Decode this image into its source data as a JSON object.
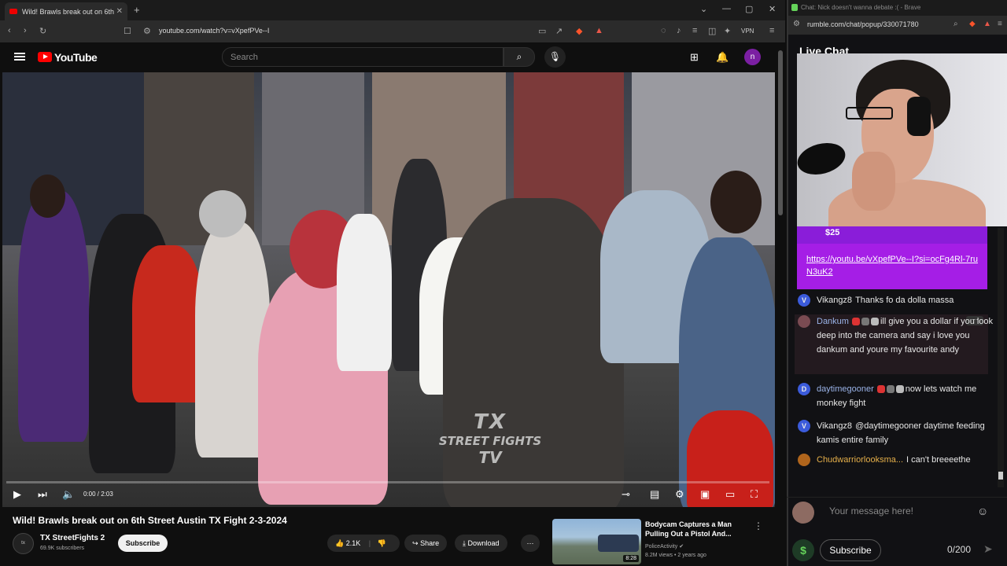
{
  "left_browser": {
    "tab_title": "Wild! Brawls break out on 6th",
    "url": "youtube.com/watch?v=vXpefPVe--I",
    "vpn_label": "VPN"
  },
  "youtube": {
    "logo_text": "YouTube",
    "search_placeholder": "Search",
    "avatar_letter": "n",
    "video": {
      "watermark_line1": "TX",
      "watermark_line2": "STREET FIGHTS",
      "watermark_line3": "TV",
      "time": "0:00 / 2:03",
      "progress": 0.0
    },
    "title": "Wild! Brawls break out on 6th Street Austin TX Fight 2-3-2024",
    "channel": {
      "name": "TX StreetFights 2",
      "subs": "69.9K subscribers",
      "avatar_text": "tx"
    },
    "subscribe_label": "Subscribe",
    "likes": "2.1K",
    "share_label": "Share",
    "download_label": "Download",
    "recommended": {
      "title": "Bodycam Captures a Man Pulling Out a Pistol And...",
      "channel": "PoliceActivity",
      "meta": "8.2M views • 2 years ago",
      "duration": "8:28"
    }
  },
  "right_browser": {
    "tab_title": "Chat: Nick doesn't wanna debate :( - Brave",
    "url": "rumble.com/chat/popup/330071780",
    "header": "Live Chat",
    "rant": {
      "amount": "$25",
      "link": "https://youtu.be/vXpefPVe--I?si=ocFg4Rl-7ruN3uK2"
    },
    "messages": [
      {
        "user": "Vikangz8",
        "initial": "V",
        "color": "#3b5bdb",
        "ucolor": "#e8e8e8",
        "text": "Thanks fo da dolla massa"
      },
      {
        "user": "Dankum",
        "initial": "",
        "color": "#7a4b52",
        "ucolor": "#9ab3e8",
        "text": "ill give you a dollar if you look deep into the camera and say i love you dankum and youre my favourite andy"
      },
      {
        "user": "daytimegooner",
        "initial": "D",
        "color": "#3b5bdb",
        "ucolor": "#9ab3e8",
        "text": "now lets watch me monkey fight"
      },
      {
        "user": "Vikangz8",
        "initial": "V",
        "color": "#3b5bdb",
        "ucolor": "#e8e8e8",
        "text": "@daytimegooner daytime feeding kamis entire family"
      },
      {
        "user": "Chudwarriorlooksma...",
        "initial": "",
        "color": "#b0651c",
        "ucolor": "#e6b04a",
        "text": "I can't breeeethe"
      }
    ],
    "input_placeholder": "Your message here!",
    "subscribe_label": "Subscribe",
    "char_count": "0/200"
  }
}
